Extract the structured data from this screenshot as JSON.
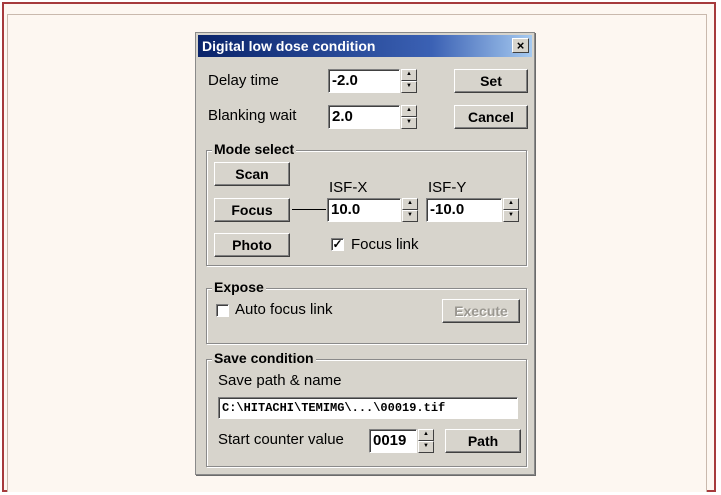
{
  "dialog": {
    "title": "Digital low dose condition",
    "close_label": "×"
  },
  "top": {
    "delay_label": "Delay time",
    "delay_value": "-2.0",
    "blanking_label": "Blanking wait",
    "blanking_value": "2.0",
    "set_label": "Set",
    "cancel_label": "Cancel"
  },
  "mode_select": {
    "title": "Mode select",
    "scan_label": "Scan",
    "focus_label": "Focus",
    "photo_label": "Photo",
    "isf_x_label": "ISF-X",
    "isf_x_value": "10.0",
    "isf_y_label": "ISF-Y",
    "isf_y_value": "-10.0",
    "focus_link_label": "Focus link",
    "focus_link_checked": true
  },
  "expose": {
    "title": "Expose",
    "auto_focus_label": "Auto focus link",
    "auto_focus_checked": false,
    "execute_label": "Execute"
  },
  "save_condition": {
    "title": "Save condition",
    "path_label": "Save path & name",
    "path_value": "C:\\HITACHI\\TEMIMG\\...\\00019.tif",
    "counter_label": "Start counter value",
    "counter_value": "0019",
    "path_button_label": "Path"
  },
  "colors": {
    "frame": "#a63a3c",
    "titlebar": "#0a246a",
    "dialog_bg": "#d7d4cc"
  }
}
